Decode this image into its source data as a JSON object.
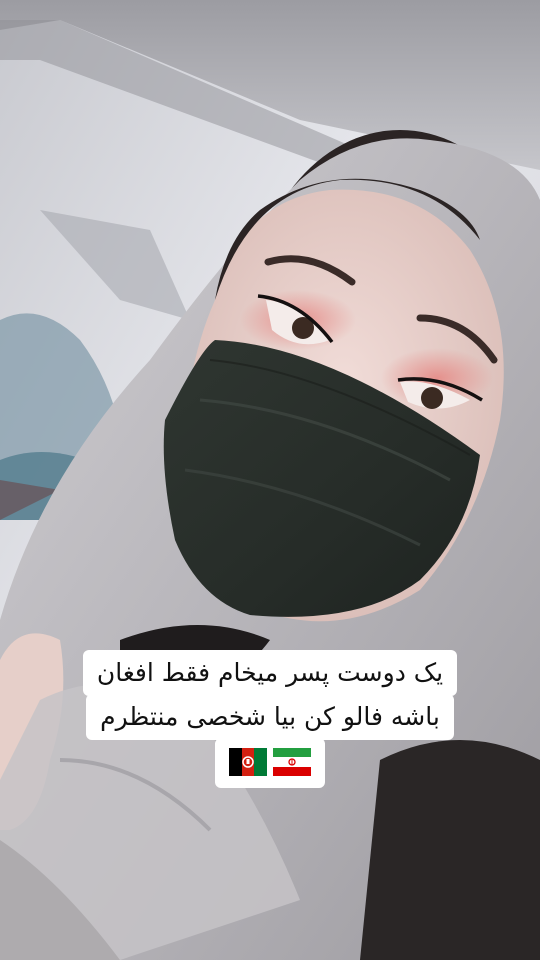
{
  "caption": {
    "line1": "یک دوست پسر میخام فقط افغان",
    "line2": "باشه فالو کن بیا شخصی منتظرم"
  },
  "flags": [
    {
      "name": "afghanistan-flag",
      "colors": [
        "#000000",
        "#d32011",
        "#007a36"
      ]
    },
    {
      "name": "iran-flag",
      "colors": [
        "#239f40",
        "#ffffff",
        "#da0000"
      ]
    }
  ],
  "colors": {
    "hijab": "#bdbbbf",
    "mask": "#2a312c",
    "skin": "#e9d3cf",
    "background": "#d9dadf"
  }
}
